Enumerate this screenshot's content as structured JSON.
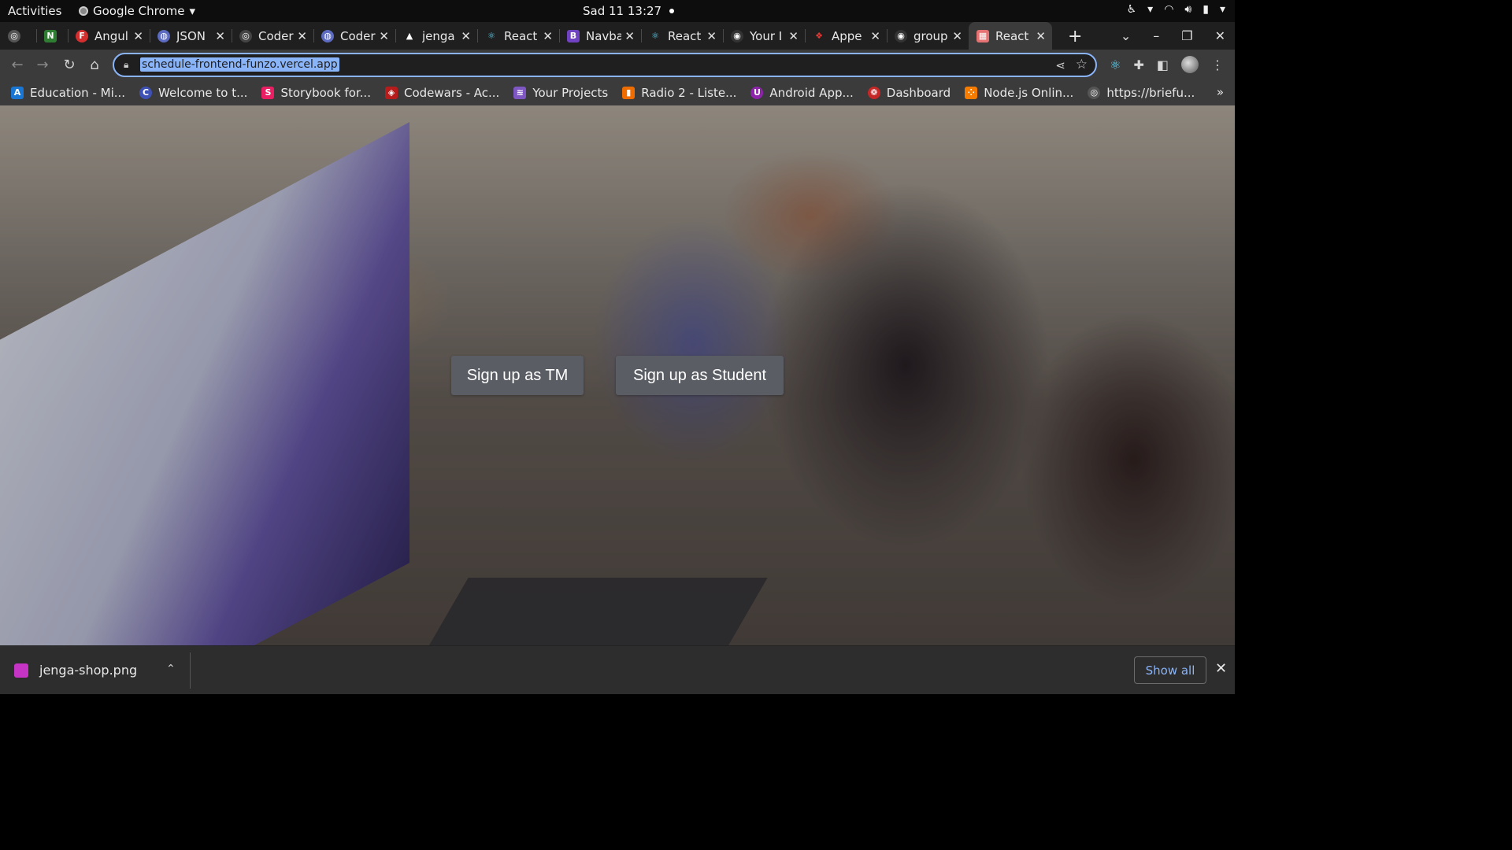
{
  "gnome": {
    "activities": "Activities",
    "app_name": "Google Chrome",
    "app_menu_arrow": "▾",
    "clock": "Sad 11  13:27"
  },
  "tabs": [
    {
      "label": "",
      "favicon": "globe-icon",
      "color": "#555555"
    },
    {
      "label": "",
      "favicon": "N",
      "color": "#2e7d32"
    },
    {
      "label": "Angul",
      "favicon": "F",
      "color": "#d32f2f"
    },
    {
      "label": "JSON",
      "favicon": "◍",
      "color": "#5c6bc0"
    },
    {
      "label": "Coder",
      "favicon": "◎",
      "color": "#444444"
    },
    {
      "label": "Coder",
      "favicon": "◍",
      "color": "#5c6bc0"
    },
    {
      "label": "jenga",
      "favicon": "▲",
      "color": "#1f1f1f"
    },
    {
      "label": "React",
      "favicon": "⚛",
      "color": "#1f1f1f"
    },
    {
      "label": "Navba",
      "favicon": "B",
      "color": "#6f42c1"
    },
    {
      "label": "React",
      "favicon": "⚛",
      "color": "#1f1f1f"
    },
    {
      "label": "Your I",
      "favicon": "◉",
      "color": "#333333"
    },
    {
      "label": "Appe",
      "favicon": "❖",
      "color": "#e53935"
    },
    {
      "label": "group",
      "favicon": "◉",
      "color": "#333333"
    },
    {
      "label": "React",
      "favicon": "▦",
      "color": "#e57373",
      "active": true
    }
  ],
  "toolbar": {
    "url": "schedule-frontend-funzo.vercel.app"
  },
  "bookmarks": [
    {
      "label": "Education - Mi...",
      "favicon": "A",
      "color": "#1976d2"
    },
    {
      "label": "Welcome to t...",
      "favicon": "C",
      "color": "#3f51b5"
    },
    {
      "label": "Storybook for...",
      "favicon": "S",
      "color": "#e91e63"
    },
    {
      "label": "Codewars - Ac...",
      "favicon": "◈",
      "color": "#b71c1c"
    },
    {
      "label": "Your Projects",
      "favicon": "≋",
      "color": "#7e57c2"
    },
    {
      "label": "Radio 2 - Liste...",
      "favicon": "▮",
      "color": "#ef6c00"
    },
    {
      "label": "Android App...",
      "favicon": "U",
      "color": "#8e24aa"
    },
    {
      "label": "Dashboard",
      "favicon": "❁",
      "color": "#c62828"
    },
    {
      "label": "Node.js Onlin...",
      "favicon": "⁘",
      "color": "#f57c00"
    },
    {
      "label": "https://briefu...",
      "favicon": "◎",
      "color": "#555555"
    }
  ],
  "page": {
    "signup_tm": "Sign up as TM",
    "signup_student": "Sign up as Student"
  },
  "downloads": {
    "file_name": "jenga-shop.png",
    "show_all": "Show all"
  }
}
